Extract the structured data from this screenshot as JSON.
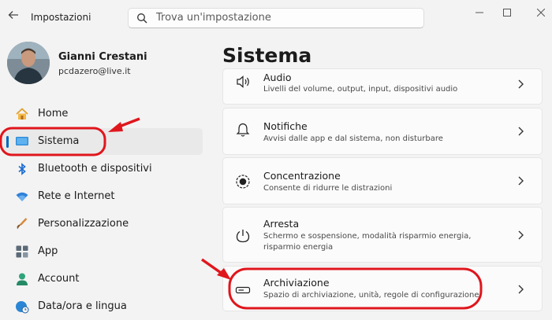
{
  "app": {
    "title": "Impostazioni"
  },
  "search": {
    "placeholder": "Trova un'impostazione"
  },
  "user": {
    "name": "Gianni Crestani",
    "email": "pcdazero@live.it"
  },
  "nav": {
    "items": [
      {
        "label": "Home",
        "icon": "home-icon"
      },
      {
        "label": "Sistema",
        "icon": "monitor-icon",
        "selected": true
      },
      {
        "label": "Bluetooth e dispositivi",
        "icon": "bluetooth-icon"
      },
      {
        "label": "Rete e Internet",
        "icon": "wifi-icon"
      },
      {
        "label": "Personalizzazione",
        "icon": "brush-icon"
      },
      {
        "label": "App",
        "icon": "apps-icon"
      },
      {
        "label": "Account",
        "icon": "account-icon"
      },
      {
        "label": "Data/ora e lingua",
        "icon": "globe-clock-icon"
      }
    ]
  },
  "page": {
    "title": "Sistema"
  },
  "settings": [
    {
      "title": "Audio",
      "subtitle": "Livelli del volume, output, input, dispositivi audio",
      "icon": "speaker-icon"
    },
    {
      "title": "Notifiche",
      "subtitle": "Avvisi dalle app e dal sistema, non disturbare",
      "icon": "bell-icon"
    },
    {
      "title": "Concentrazione",
      "subtitle": "Consente di ridurre le distrazioni",
      "icon": "focus-icon"
    },
    {
      "title": "Arresta",
      "subtitle": "Schermo e sospensione, modalità risparmio energia, risparmio energia",
      "icon": "power-icon"
    },
    {
      "title": "Archiviazione",
      "subtitle": "Spazio di archiviazione, unità, regole di configurazione",
      "icon": "storage-icon"
    }
  ],
  "colors": {
    "accent": "#0067c0",
    "annotation": "#e0161d",
    "background": "#f3f3f3",
    "card": "#fbfbfb"
  }
}
